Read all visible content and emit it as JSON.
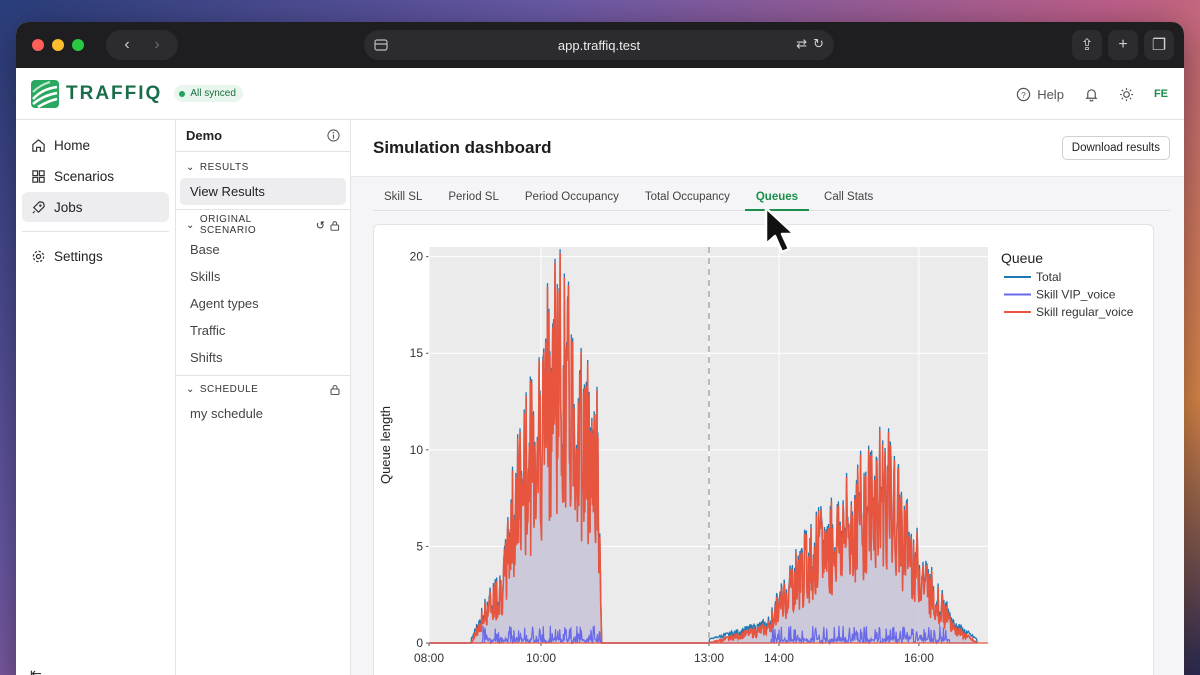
{
  "browser": {
    "url": "app.traffiq.test"
  },
  "app": {
    "brand": "TRAFFIQ",
    "sync_status": "All synced",
    "help_label": "Help",
    "avatar_initials": "FE"
  },
  "sidebar": {
    "items": [
      {
        "label": "Home",
        "icon": "home-icon"
      },
      {
        "label": "Scenarios",
        "icon": "scenarios-icon"
      },
      {
        "label": "Jobs",
        "icon": "rocket-icon"
      }
    ],
    "settings_label": "Settings"
  },
  "subpanel": {
    "title": "Demo",
    "results_section": "RESULTS",
    "results_items": [
      "View Results"
    ],
    "scenario_section": "ORIGINAL SCENARIO",
    "scenario_items": [
      "Base",
      "Skills",
      "Agent types",
      "Traffic",
      "Shifts"
    ],
    "schedule_section": "SCHEDULE",
    "schedule_items": [
      "my schedule"
    ]
  },
  "main": {
    "title": "Simulation dashboard",
    "download_label": "Download results",
    "tabs": [
      "Skill SL",
      "Period SL",
      "Period Occupancy",
      "Total Occupancy",
      "Queues",
      "Call Stats"
    ],
    "active_tab": "Queues"
  },
  "colors": {
    "accent": "#1a8e4a",
    "total": "#1f77b4",
    "vip": "#6a6ae8",
    "regular": "#e8553f"
  },
  "chart_data": {
    "type": "line",
    "ylabel": "Queue length",
    "xlabel": "",
    "x_ticks": [
      "08:00",
      "10:00",
      "13:00",
      "14:00",
      "16:00"
    ],
    "y_ticks": [
      0,
      5,
      10,
      15,
      20
    ],
    "ylim": [
      0,
      20.5
    ],
    "x_range": [
      "08:00",
      "16:50"
    ],
    "break_at": "13:00",
    "legend_title": "Queue",
    "legend_position": "top-right",
    "grid": true,
    "series": [
      {
        "name": "Total",
        "color": "#1f77b4"
      },
      {
        "name": "Skill VIP_voice",
        "color": "#6a6ae8"
      },
      {
        "name": "Skill regular_voice",
        "color": "#e8553f"
      }
    ],
    "approx_envelope": [
      {
        "x": "08:00",
        "y": 0
      },
      {
        "x": "08:45",
        "y": 0
      },
      {
        "x": "09:00",
        "y": 2
      },
      {
        "x": "09:20",
        "y": 4
      },
      {
        "x": "09:30",
        "y": 9
      },
      {
        "x": "09:45",
        "y": 12
      },
      {
        "x": "10:00",
        "y": 15
      },
      {
        "x": "10:15",
        "y": 19.3
      },
      {
        "x": "10:30",
        "y": 17
      },
      {
        "x": "10:45",
        "y": 14
      },
      {
        "x": "11:00",
        "y": 13
      },
      {
        "x": "11:05",
        "y": 0
      },
      {
        "x": "13:00",
        "y": 0
      },
      {
        "x": "13:50",
        "y": 1
      },
      {
        "x": "14:10",
        "y": 4
      },
      {
        "x": "14:30",
        "y": 6
      },
      {
        "x": "15:00",
        "y": 8
      },
      {
        "x": "15:30",
        "y": 10.7
      },
      {
        "x": "16:00",
        "y": 5
      },
      {
        "x": "16:30",
        "y": 1
      },
      {
        "x": "16:50",
        "y": 0
      }
    ]
  }
}
